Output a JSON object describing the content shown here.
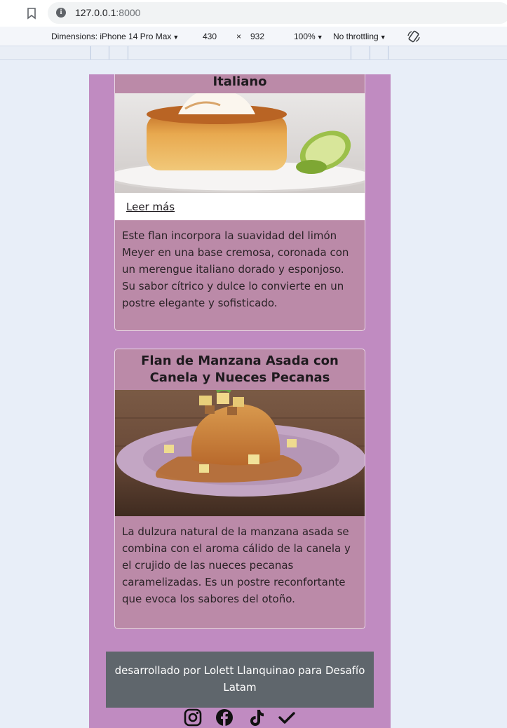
{
  "browser": {
    "url_host": "127.0.0.1",
    "url_port": ":8000"
  },
  "devtools": {
    "dimensions_label": "Dimensions: iPhone 14 Pro Max",
    "width": "430",
    "times": "×",
    "height": "932",
    "zoom": "100%",
    "throttling": "No throttling"
  },
  "cards": [
    {
      "title": "Italiano",
      "read_more": "Leer más",
      "description": "Este flan incorpora la suavidad del limón Meyer en una base cremosa, coronada con un merengue italiano dorado y esponjoso. Su sabor cítrico y dulce lo convierte en un postre elegante y sofisticado."
    },
    {
      "title": "Flan de Manzana Asada con Canela y Nueces Pecanas",
      "description": "La dulzura natural de la manzana asada se combina con el aroma cálido de la canela y el crujido de las nueces pecanas caramelizadas. Es un postre reconfortante que evoca los sabores del otoño."
    }
  ],
  "footer": {
    "credit": "desarrollado por Lolett Llanquinao para Desafío Latam"
  },
  "social_icons": [
    "instagram-icon",
    "facebook-icon",
    "tiktok-icon",
    "check-icon"
  ]
}
